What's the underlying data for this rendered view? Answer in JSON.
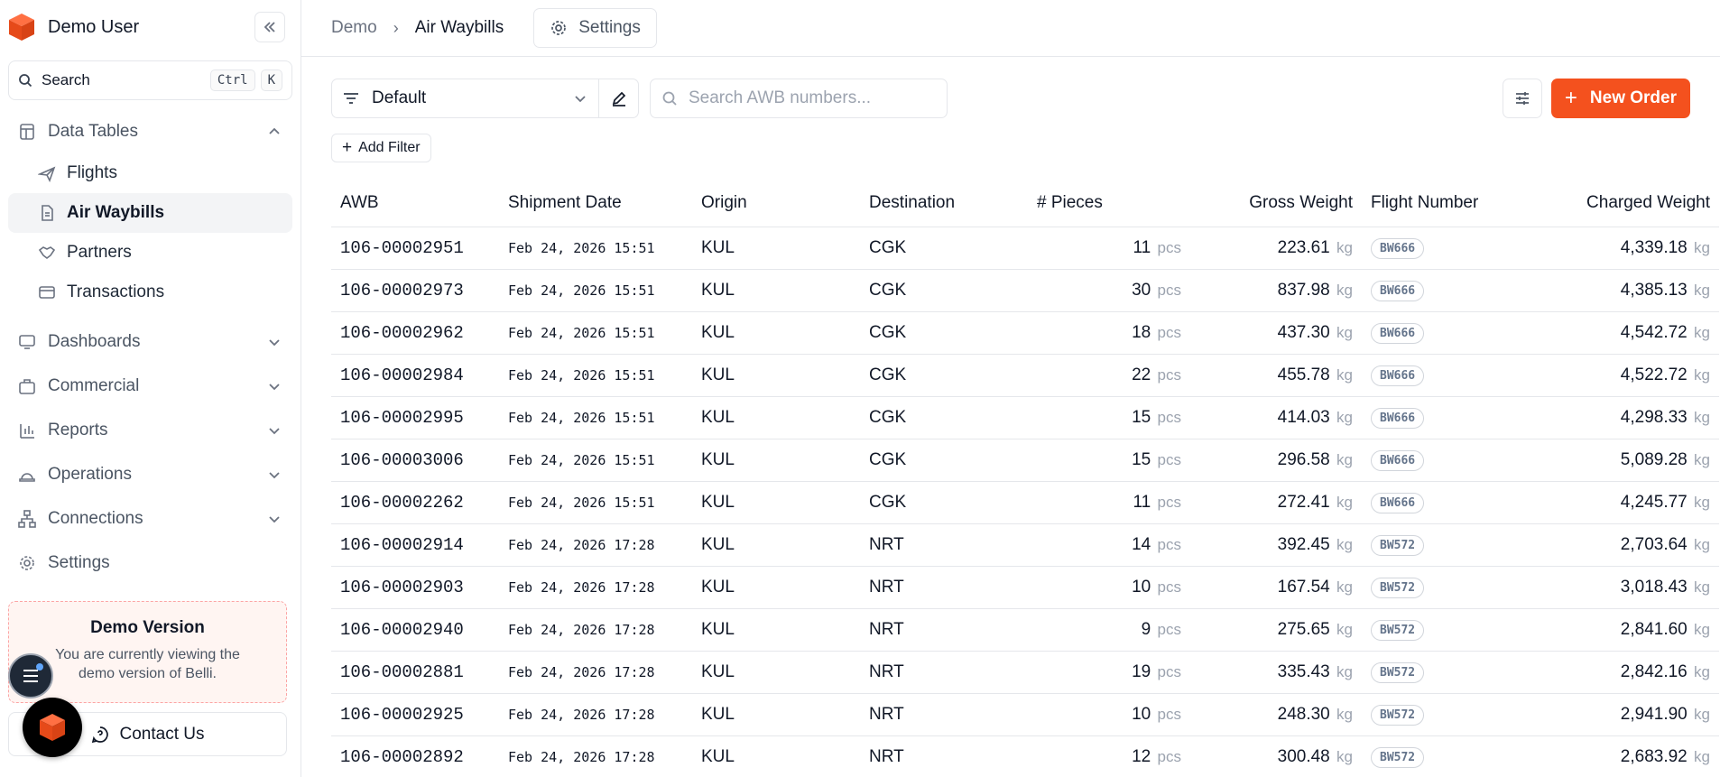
{
  "sidebar": {
    "user_name": "Demo User",
    "search_label": "Search",
    "shortcut_ctrl": "Ctrl",
    "shortcut_k": "K",
    "data_tables": {
      "label": "Data Tables",
      "items": [
        {
          "label": "Flights"
        },
        {
          "label": "Air Waybills"
        },
        {
          "label": "Partners"
        },
        {
          "label": "Transactions"
        }
      ]
    },
    "nav": [
      {
        "label": "Dashboards"
      },
      {
        "label": "Commercial"
      },
      {
        "label": "Reports"
      },
      {
        "label": "Operations"
      },
      {
        "label": "Connections"
      },
      {
        "label": "Settings"
      }
    ],
    "demo_card": {
      "title": "Demo Version",
      "desc_line1": "You are currently viewing the",
      "desc_line2": "demo version of Belli."
    },
    "contact_label": "Contact Us"
  },
  "header": {
    "crumb_root": "Demo",
    "crumb_current": "Air Waybills",
    "settings_label": "Settings"
  },
  "toolbar": {
    "view_value": "Default",
    "search_placeholder": "Search AWB numbers...",
    "new_order_label": "New Order",
    "add_filter_label": "Add Filter"
  },
  "table": {
    "columns": [
      "AWB",
      "Shipment Date",
      "Origin",
      "Destination",
      "# Pieces",
      "Gross Weight",
      "Flight Number",
      "Charged Weight"
    ],
    "unit_pcs": "pcs",
    "unit_kg": "kg",
    "rows": [
      {
        "awb": "106-00002951",
        "date": "Feb 24, 2026 15:51",
        "origin": "KUL",
        "dest": "CGK",
        "pieces": "11",
        "gross": "223.61",
        "flight": "BW666",
        "charged": "4,339.18"
      },
      {
        "awb": "106-00002973",
        "date": "Feb 24, 2026 15:51",
        "origin": "KUL",
        "dest": "CGK",
        "pieces": "30",
        "gross": "837.98",
        "flight": "BW666",
        "charged": "4,385.13"
      },
      {
        "awb": "106-00002962",
        "date": "Feb 24, 2026 15:51",
        "origin": "KUL",
        "dest": "CGK",
        "pieces": "18",
        "gross": "437.30",
        "flight": "BW666",
        "charged": "4,542.72"
      },
      {
        "awb": "106-00002984",
        "date": "Feb 24, 2026 15:51",
        "origin": "KUL",
        "dest": "CGK",
        "pieces": "22",
        "gross": "455.78",
        "flight": "BW666",
        "charged": "4,522.72"
      },
      {
        "awb": "106-00002995",
        "date": "Feb 24, 2026 15:51",
        "origin": "KUL",
        "dest": "CGK",
        "pieces": "15",
        "gross": "414.03",
        "flight": "BW666",
        "charged": "4,298.33"
      },
      {
        "awb": "106-00003006",
        "date": "Feb 24, 2026 15:51",
        "origin": "KUL",
        "dest": "CGK",
        "pieces": "15",
        "gross": "296.58",
        "flight": "BW666",
        "charged": "5,089.28"
      },
      {
        "awb": "106-00002262",
        "date": "Feb 24, 2026 15:51",
        "origin": "KUL",
        "dest": "CGK",
        "pieces": "11",
        "gross": "272.41",
        "flight": "BW666",
        "charged": "4,245.77"
      },
      {
        "awb": "106-00002914",
        "date": "Feb 24, 2026 17:28",
        "origin": "KUL",
        "dest": "NRT",
        "pieces": "14",
        "gross": "392.45",
        "flight": "BW572",
        "charged": "2,703.64"
      },
      {
        "awb": "106-00002903",
        "date": "Feb 24, 2026 17:28",
        "origin": "KUL",
        "dest": "NRT",
        "pieces": "10",
        "gross": "167.54",
        "flight": "BW572",
        "charged": "3,018.43"
      },
      {
        "awb": "106-00002940",
        "date": "Feb 24, 2026 17:28",
        "origin": "KUL",
        "dest": "NRT",
        "pieces": "9",
        "gross": "275.65",
        "flight": "BW572",
        "charged": "2,841.60"
      },
      {
        "awb": "106-00002881",
        "date": "Feb 24, 2026 17:28",
        "origin": "KUL",
        "dest": "NRT",
        "pieces": "19",
        "gross": "335.43",
        "flight": "BW572",
        "charged": "2,842.16"
      },
      {
        "awb": "106-00002925",
        "date": "Feb 24, 2026 17:28",
        "origin": "KUL",
        "dest": "NRT",
        "pieces": "10",
        "gross": "248.30",
        "flight": "BW572",
        "charged": "2,941.90"
      },
      {
        "awb": "106-00002892",
        "date": "Feb 24, 2026 17:28",
        "origin": "KUL",
        "dest": "NRT",
        "pieces": "12",
        "gross": "300.48",
        "flight": "BW572",
        "charged": "2,683.92"
      }
    ]
  },
  "colors": {
    "accent": "#f4511e",
    "active_bg": "#f3f4f6",
    "border": "#e5e7eb"
  }
}
